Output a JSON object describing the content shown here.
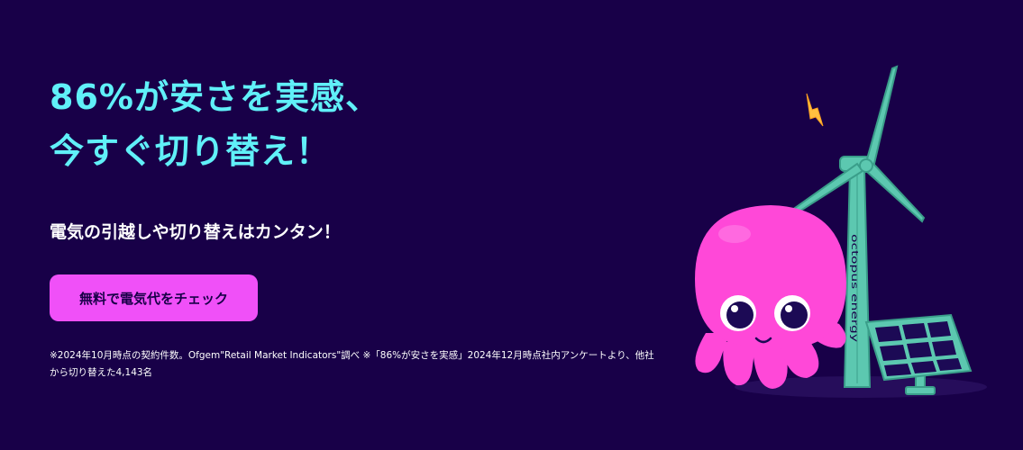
{
  "hero": {
    "headline_line1": "86%が安さを実感、",
    "headline_line2": "今すぐ切り替え！",
    "subheadline": "電気の引越しや切り替えはカンタン！",
    "cta_label": "無料で電気代をチェック",
    "footnote": "※2024年10月時点の契約件数。Ofgem\"Retail Market Indicators\"調べ ※「86%が安さを実感」2024年12月時点社内アンケートより、他社から切り替えた4,143名"
  },
  "illustration": {
    "turbine_brand": "octopus energy",
    "icons": [
      "lightning-bolt-icon",
      "wind-turbine",
      "solar-panel",
      "octopus-mascot"
    ]
  },
  "colors": {
    "background": "#180048",
    "headline": "#60f0f8",
    "cta_background": "#f050f8",
    "cta_text": "#180048",
    "turbine": "#5cc8b0",
    "octopus": "#ff48d8",
    "bolt": "#ffc040"
  }
}
